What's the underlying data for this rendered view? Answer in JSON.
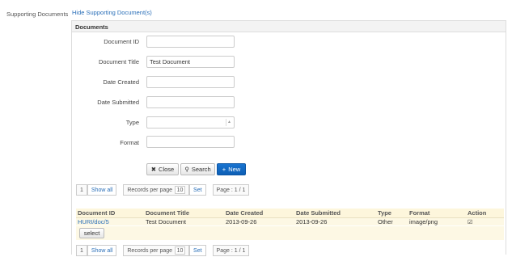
{
  "sidebar": {
    "label": "Supporting Documents"
  },
  "toggle_link": "Hide Supporting Document(s)",
  "panel": {
    "title": "Documents"
  },
  "form": {
    "document_id": {
      "label": "Document ID",
      "value": ""
    },
    "document_title": {
      "label": "Document Title",
      "value": "Test Document"
    },
    "date_created": {
      "label": "Date Created",
      "value": ""
    },
    "date_submitted": {
      "label": "Date Submitted",
      "value": ""
    },
    "type": {
      "label": "Type",
      "value": ""
    },
    "format": {
      "label": "Format",
      "value": ""
    }
  },
  "buttons": {
    "close": "Close",
    "search": "Search",
    "new": "New"
  },
  "pager": {
    "page_num": "1",
    "show_all": "Show all",
    "records_per_page_label": "Records per page",
    "records_per_page_value": "10",
    "set": "Set",
    "page_info": "Page : 1 / 1"
  },
  "table": {
    "headers": [
      "Document ID",
      "Document Title",
      "Date Created",
      "Date Submitted",
      "Type",
      "Format",
      "Action"
    ],
    "rows": [
      {
        "document_id": "HURI/doc/5",
        "document_title": "Test Document",
        "date_created": "2013-09-26",
        "date_submitted": "2013-09-26",
        "type": "Other",
        "format": "image/png",
        "action_checked": true
      }
    ],
    "select_button": "select"
  }
}
